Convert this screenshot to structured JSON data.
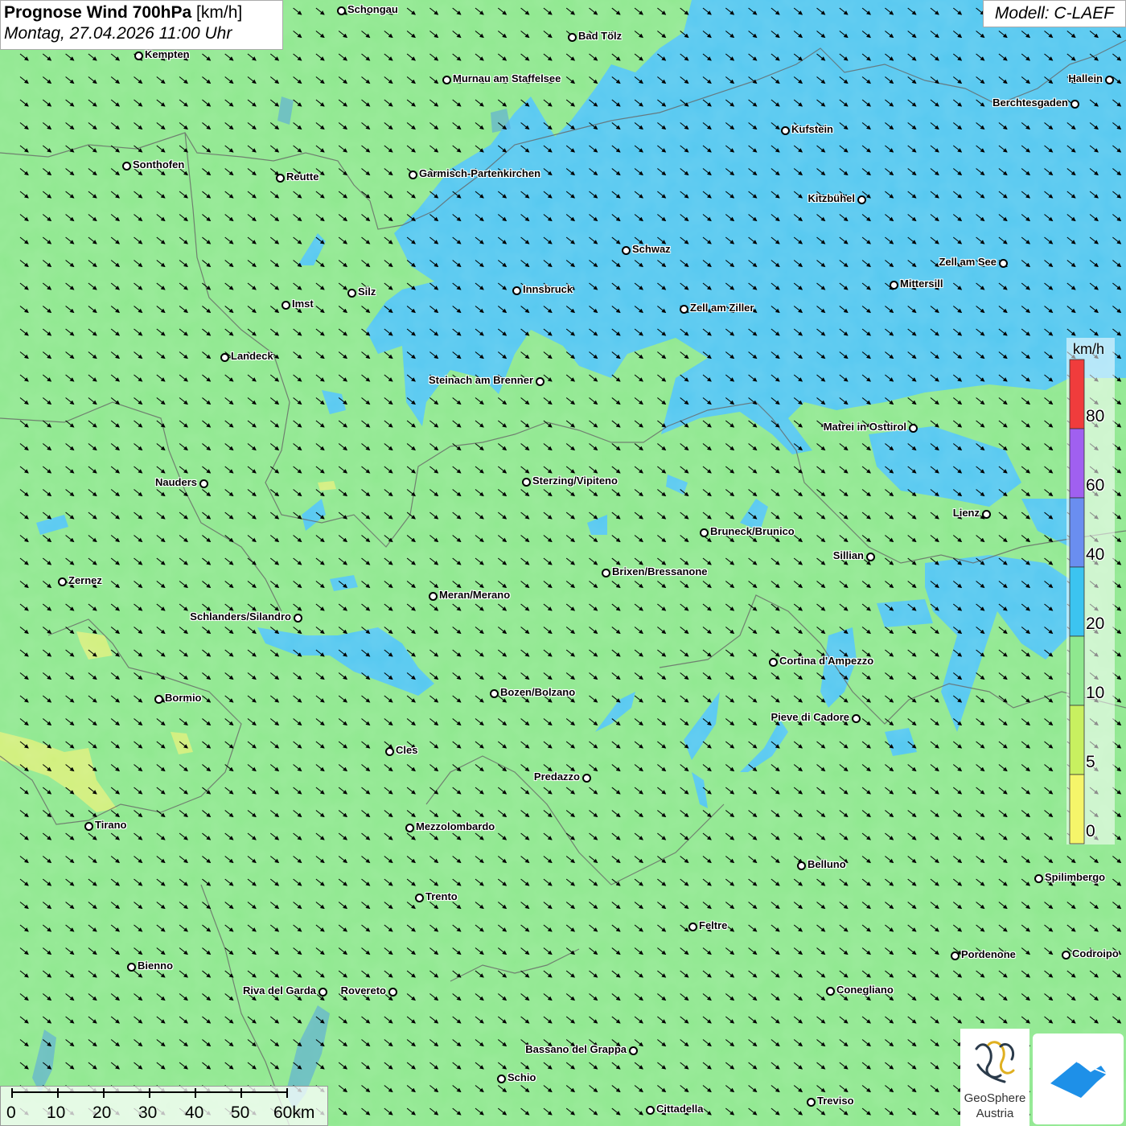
{
  "header": {
    "title_bold": "Prognose Wind 700hPa",
    "title_unit": "[km/h]",
    "datetime": "Montag, 27.04.2026 11:00 Uhr",
    "model": "Modell: C-LAEF"
  },
  "colors": {
    "background_10_20": "#8fe88f",
    "band_20_40": "#55c8f0",
    "band_5_10": "#d8f07a",
    "wind_arrow": "#000000"
  },
  "legend": {
    "unit": "km/h",
    "labels": [
      "80",
      "60",
      "40",
      "20",
      "10",
      "5",
      "0"
    ],
    "bands": [
      {
        "from": 0,
        "to": 5,
        "color": "#f5f56a"
      },
      {
        "from": 5,
        "to": 10,
        "color": "#c8f060"
      },
      {
        "from": 10,
        "to": 20,
        "color": "#8fe88f"
      },
      {
        "from": 20,
        "to": 40,
        "color": "#3cc4f0"
      },
      {
        "from": 40,
        "to": 60,
        "color": "#6a8ef0"
      },
      {
        "from": 60,
        "to": 80,
        "color": "#a060f0"
      },
      {
        "from": 80,
        "to": 100,
        "color": "#f03c3c"
      }
    ]
  },
  "wind": {
    "direction": "north-west",
    "arrow_icon": "wind-arrow-icon"
  },
  "scalebar": {
    "labels": [
      "0",
      "10",
      "20",
      "30",
      "40",
      "50",
      "60km"
    ]
  },
  "logos": {
    "geosphere_line1": "GeoSphere",
    "geosphere_line2": "Austria",
    "app_icon": "app-logo-icon"
  },
  "cities": [
    {
      "name": "Schongau"
    },
    {
      "name": "Bad Tölz"
    },
    {
      "name": "Kempten"
    },
    {
      "name": "Murnau am Staffelsee"
    },
    {
      "name": "Hallein"
    },
    {
      "name": "Berchtesgaden"
    },
    {
      "name": "Kufstein"
    },
    {
      "name": "Sonthofen"
    },
    {
      "name": "Reutte"
    },
    {
      "name": "Garmisch-Partenkirchen"
    },
    {
      "name": "Kitzbühel"
    },
    {
      "name": "Schwaz"
    },
    {
      "name": "Zell am See"
    },
    {
      "name": "Mittersill"
    },
    {
      "name": "Silz"
    },
    {
      "name": "Innsbruck"
    },
    {
      "name": "Imst"
    },
    {
      "name": "Zell am Ziller"
    },
    {
      "name": "Landeck"
    },
    {
      "name": "Steinach am Brenner"
    },
    {
      "name": "Matrei in Osttirol"
    },
    {
      "name": "Nauders"
    },
    {
      "name": "Sterzing/Vipiteno"
    },
    {
      "name": "Lienz"
    },
    {
      "name": "Bruneck/Brunico"
    },
    {
      "name": "Sillian"
    },
    {
      "name": "Zernez"
    },
    {
      "name": "Brixen/Bressanone"
    },
    {
      "name": "Meran/Merano"
    },
    {
      "name": "Schlanders/Silandro"
    },
    {
      "name": "Cortina d'Ampezzo"
    },
    {
      "name": "Bozen/Bolzano"
    },
    {
      "name": "Bormio"
    },
    {
      "name": "Pieve di Cadore"
    },
    {
      "name": "Cles"
    },
    {
      "name": "Predazzo"
    },
    {
      "name": "Tirano"
    },
    {
      "name": "Mezzolombardo"
    },
    {
      "name": "Belluno"
    },
    {
      "name": "Spilimbergo"
    },
    {
      "name": "Trento"
    },
    {
      "name": "Feltre"
    },
    {
      "name": "Pordenone"
    },
    {
      "name": "Codroipo"
    },
    {
      "name": "Bienno"
    },
    {
      "name": "Riva del Garda"
    },
    {
      "name": "Rovereto"
    },
    {
      "name": "Conegliano"
    },
    {
      "name": "Bassano del Grappa"
    },
    {
      "name": "Schio"
    },
    {
      "name": "Treviso"
    },
    {
      "name": "Cittadella"
    }
  ]
}
